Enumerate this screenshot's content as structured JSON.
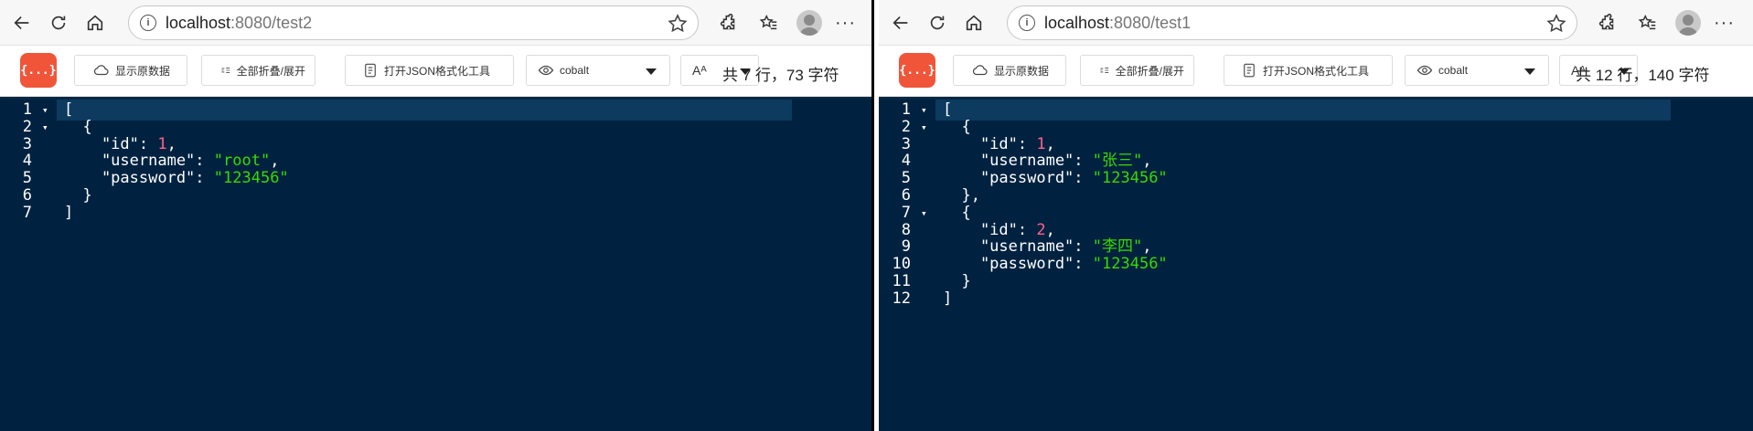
{
  "windows": [
    {
      "url_host": "localhost",
      "url_path": ":8080/test2",
      "toolbar": {
        "logo": "{...}",
        "raw_label": "显示原数据",
        "fold_label": "全部折叠/展开",
        "format_label": "打开JSON格式化工具",
        "theme_value": "cobalt",
        "font_label": "Aᴬ",
        "stats": "共 7 行，73 字符"
      },
      "lines": [
        {
          "n": "1",
          "fold": true,
          "parts": [
            {
              "t": "[",
              "c": "pun"
            }
          ]
        },
        {
          "n": "2",
          "fold": true,
          "parts": [
            {
              "t": "  {",
              "c": "pun"
            }
          ]
        },
        {
          "n": "3",
          "fold": false,
          "parts": [
            {
              "t": "    \"id\"",
              "c": "k"
            },
            {
              "t": ": ",
              "c": "pun"
            },
            {
              "t": "1",
              "c": "num"
            },
            {
              "t": ",",
              "c": "pun"
            }
          ]
        },
        {
          "n": "4",
          "fold": false,
          "parts": [
            {
              "t": "    \"username\"",
              "c": "k"
            },
            {
              "t": ": ",
              "c": "pun"
            },
            {
              "t": "\"root\"",
              "c": "str"
            },
            {
              "t": ",",
              "c": "pun"
            }
          ]
        },
        {
          "n": "5",
          "fold": false,
          "parts": [
            {
              "t": "    \"password\"",
              "c": "k"
            },
            {
              "t": ": ",
              "c": "pun"
            },
            {
              "t": "\"123456\"",
              "c": "str"
            }
          ]
        },
        {
          "n": "6",
          "fold": false,
          "parts": [
            {
              "t": "  }",
              "c": "pun"
            }
          ]
        },
        {
          "n": "7",
          "fold": false,
          "parts": [
            {
              "t": "]",
              "c": "pun"
            }
          ]
        }
      ]
    },
    {
      "url_host": "localhost",
      "url_path": ":8080/test1",
      "toolbar": {
        "logo": "{...}",
        "raw_label": "显示原数据",
        "fold_label": "全部折叠/展开",
        "format_label": "打开JSON格式化工具",
        "theme_value": "cobalt",
        "font_label": "Aᴬ",
        "stats": "共 12 行，140 字符"
      },
      "lines": [
        {
          "n": "1",
          "fold": true,
          "parts": [
            {
              "t": "[",
              "c": "pun"
            }
          ]
        },
        {
          "n": "2",
          "fold": true,
          "parts": [
            {
              "t": "  {",
              "c": "pun"
            }
          ]
        },
        {
          "n": "3",
          "fold": false,
          "parts": [
            {
              "t": "    \"id\"",
              "c": "k"
            },
            {
              "t": ": ",
              "c": "pun"
            },
            {
              "t": "1",
              "c": "num"
            },
            {
              "t": ",",
              "c": "pun"
            }
          ]
        },
        {
          "n": "4",
          "fold": false,
          "parts": [
            {
              "t": "    \"username\"",
              "c": "k"
            },
            {
              "t": ": ",
              "c": "pun"
            },
            {
              "t": "\"张三\"",
              "c": "str"
            },
            {
              "t": ",",
              "c": "pun"
            }
          ]
        },
        {
          "n": "5",
          "fold": false,
          "parts": [
            {
              "t": "    \"password\"",
              "c": "k"
            },
            {
              "t": ": ",
              "c": "pun"
            },
            {
              "t": "\"123456\"",
              "c": "str"
            }
          ]
        },
        {
          "n": "6",
          "fold": false,
          "parts": [
            {
              "t": "  },",
              "c": "pun"
            }
          ]
        },
        {
          "n": "7",
          "fold": true,
          "parts": [
            {
              "t": "  {",
              "c": "pun"
            }
          ]
        },
        {
          "n": "8",
          "fold": false,
          "parts": [
            {
              "t": "    \"id\"",
              "c": "k"
            },
            {
              "t": ": ",
              "c": "pun"
            },
            {
              "t": "2",
              "c": "num"
            },
            {
              "t": ",",
              "c": "pun"
            }
          ]
        },
        {
          "n": "9",
          "fold": false,
          "parts": [
            {
              "t": "    \"username\"",
              "c": "k"
            },
            {
              "t": ": ",
              "c": "pun"
            },
            {
              "t": "\"李四\"",
              "c": "str"
            },
            {
              "t": ",",
              "c": "pun"
            }
          ]
        },
        {
          "n": "10",
          "fold": false,
          "parts": [
            {
              "t": "    \"password\"",
              "c": "k"
            },
            {
              "t": ": ",
              "c": "pun"
            },
            {
              "t": "\"123456\"",
              "c": "str"
            }
          ]
        },
        {
          "n": "11",
          "fold": false,
          "parts": [
            {
              "t": "  }",
              "c": "pun"
            }
          ]
        },
        {
          "n": "12",
          "fold": false,
          "parts": [
            {
              "t": "]",
              "c": "pun"
            }
          ]
        }
      ]
    }
  ],
  "colors": {
    "editor_bg": "#002240",
    "number": "#ff628c",
    "string": "#3ad900",
    "logo_bg": "#f0553a"
  },
  "icons": [
    "back-arrow-icon",
    "refresh-icon",
    "home-icon",
    "info-icon",
    "star-icon",
    "extensions-icon",
    "favorites-icon",
    "profile-avatar",
    "more-icon",
    "cloud-icon",
    "fold-icon",
    "format-tool-icon",
    "theme-eye-icon",
    "chevron-down-icon"
  ]
}
